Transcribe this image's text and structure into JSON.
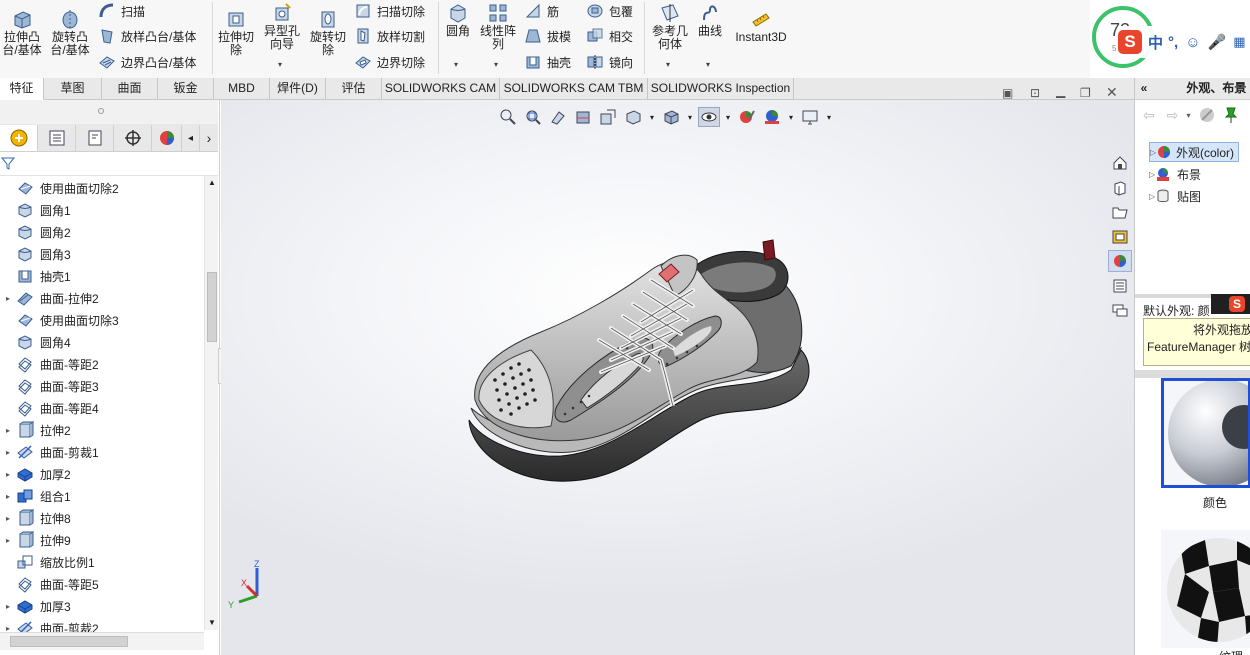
{
  "ribbon": {
    "group1": [
      {
        "label": "拉伸凸\n台/基体",
        "icon": "extruded-boss-icon"
      },
      {
        "label": "旋转凸\n台/基体",
        "icon": "revolved-boss-icon"
      }
    ],
    "group1_small": [
      "扫描",
      "放样凸台/基体",
      "边界凸台/基体"
    ],
    "group2": [
      {
        "label": "拉伸切\n除",
        "icon": "extruded-cut-icon"
      },
      {
        "label": "异型孔\n向导",
        "icon": "hole-wizard-icon"
      },
      {
        "label": "旋转切\n除",
        "icon": "revolved-cut-icon"
      }
    ],
    "group2_small": [
      "扫描切除",
      "放样切割",
      "边界切除"
    ],
    "group3_big": [
      {
        "label": "圆角",
        "icon": "fillet-icon"
      },
      {
        "label": "线性阵\n列",
        "icon": "linear-pattern-icon"
      }
    ],
    "group3_small_a": [
      "筋",
      "拔模",
      "抽壳"
    ],
    "group3_small_b": [
      "包覆",
      "相交",
      "镜向"
    ],
    "group4": [
      {
        "label": "参考几\n何体",
        "icon": "reference-geometry-icon"
      },
      {
        "label": "曲线",
        "icon": "curves-icon"
      },
      {
        "label": "Instant3D",
        "icon": "instant3d-icon"
      }
    ]
  },
  "tabs": [
    "特征",
    "草图",
    "曲面",
    "钣金",
    "MBD",
    "焊件(D)",
    "评估",
    "SOLIDWORKS CAM",
    "SOLIDWORKS CAM TBM",
    "SOLIDWORKS Inspection"
  ],
  "active_tab": "特征",
  "feature_tree": [
    {
      "label": "使用曲面切除2",
      "icon": "surface-cut-icon",
      "expandable": false
    },
    {
      "label": "圆角1",
      "icon": "fillet-icon",
      "expandable": false
    },
    {
      "label": "圆角2",
      "icon": "fillet-icon",
      "expandable": false
    },
    {
      "label": "圆角3",
      "icon": "fillet-icon",
      "expandable": false
    },
    {
      "label": "抽壳1",
      "icon": "shell-icon",
      "expandable": false
    },
    {
      "label": "曲面-拉伸2",
      "icon": "surface-extrude-icon",
      "expandable": true
    },
    {
      "label": "使用曲面切除3",
      "icon": "surface-cut-icon",
      "expandable": false
    },
    {
      "label": "圆角4",
      "icon": "fillet-icon",
      "expandable": false
    },
    {
      "label": "曲面-等距2",
      "icon": "surface-offset-icon",
      "expandable": false
    },
    {
      "label": "曲面-等距3",
      "icon": "surface-offset-icon",
      "expandable": false
    },
    {
      "label": "曲面-等距4",
      "icon": "surface-offset-icon",
      "expandable": false
    },
    {
      "label": "拉伸2",
      "icon": "extrude-icon",
      "expandable": true
    },
    {
      "label": "曲面-剪裁1",
      "icon": "surface-trim-icon",
      "expandable": true
    },
    {
      "label": "加厚2",
      "icon": "thicken-icon",
      "expandable": true
    },
    {
      "label": "组合1",
      "icon": "combine-icon",
      "expandable": true
    },
    {
      "label": "拉伸8",
      "icon": "extrude-icon",
      "expandable": true
    },
    {
      "label": "拉伸9",
      "icon": "extrude-icon",
      "expandable": true
    },
    {
      "label": "缩放比例1",
      "icon": "scale-icon",
      "expandable": false
    },
    {
      "label": "曲面-等距5",
      "icon": "surface-offset-icon",
      "expandable": false
    },
    {
      "label": "加厚3",
      "icon": "thicken-icon",
      "expandable": true
    },
    {
      "label": "曲面-剪裁2",
      "icon": "surface-trim-icon",
      "expandable": true
    }
  ],
  "right_pane": {
    "title": "外观、布景",
    "tree": [
      "外观(color)",
      "布景",
      "贴图"
    ],
    "default_appearance": "默认外观: 颜",
    "tooltip_line1": "将外观拖放",
    "tooltip_line2": "FeatureManager 树",
    "swatches": [
      "颜色",
      "纹理"
    ]
  },
  "triad": {
    "x": "X",
    "y": "Y",
    "z": "Z"
  },
  "overlay": {
    "badge": "72",
    "badge_sub": "5",
    "ime_text": "中",
    "ime_punct": "°,"
  },
  "colors": {
    "accent_blue": "#1f4fd8",
    "ribbon_bg": "#f7f7f7",
    "tooltip_bg": "#ffffd8"
  }
}
